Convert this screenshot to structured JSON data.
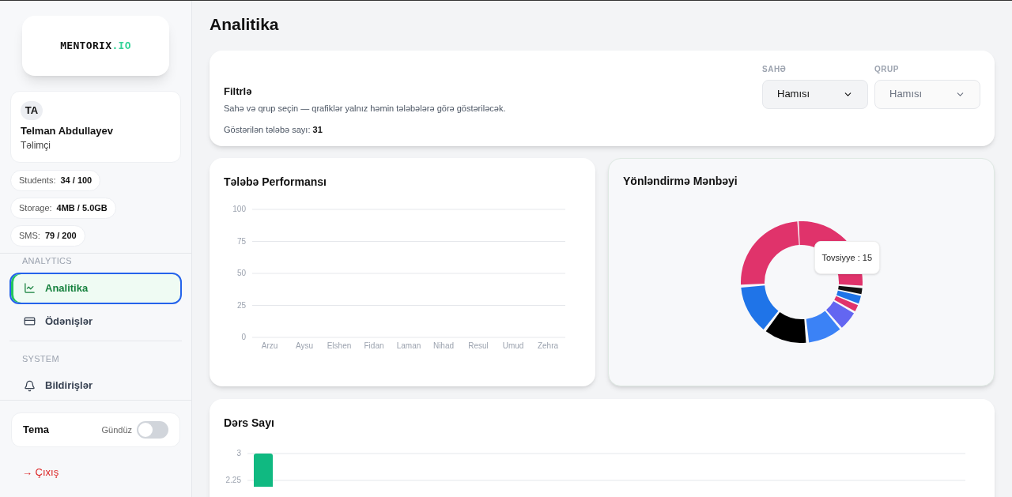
{
  "sidebar": {
    "logo": {
      "main": "MENTORIX",
      "suffix": ".IO"
    },
    "user": {
      "initials": "TA",
      "name": "Telman Abdullayev",
      "role": "Təlimçi"
    },
    "usage": [
      {
        "label": "Students:",
        "value": "34 / 100"
      },
      {
        "label": "Storage:",
        "value": "4MB / 5.0GB"
      },
      {
        "label": "SMS:",
        "value": "79 / 200"
      }
    ],
    "sections": [
      {
        "title": "ANALYTICS",
        "items": [
          {
            "label": "Analitika",
            "selected": true
          },
          {
            "label": "Ödənişlər",
            "selected": false
          }
        ]
      },
      {
        "title": "SYSTEM",
        "items": [
          {
            "label": "Bildirişlər",
            "selected": false
          }
        ]
      }
    ],
    "theme": {
      "label": "Tema",
      "mode_label": "Gündüz",
      "on": false
    },
    "logout": "→ Çıxış"
  },
  "page_title": "Analitika",
  "filter": {
    "title": "Filtrlə",
    "description": "Sahə və qrup seçin — qrafiklər yalnız həmin tələbələrə görə göstəriləcək.",
    "count_label": "Göstərilən tələbə sayı:",
    "count": "31",
    "selects": [
      {
        "label": "SAHƏ",
        "value": "Hamısı",
        "disabled": false
      },
      {
        "label": "QRUP",
        "value": "Hamısı",
        "disabled": true
      }
    ]
  },
  "performance": {
    "title": "Tələbə Performansı",
    "chart_data": {
      "type": "bar",
      "categories": [
        "Arzu",
        "Aysu",
        "Elshen",
        "Fidan",
        "Laman",
        "Nihad",
        "Resul",
        "Umud",
        "Zehra"
      ],
      "values": [
        0,
        0,
        0,
        0,
        0,
        0,
        0,
        0,
        0
      ],
      "ylim": [
        0,
        100
      ],
      "yticks": [
        0,
        25,
        50,
        75,
        100
      ],
      "grid": true
    }
  },
  "sources": {
    "title": "Yönləndirmə Mənbəyi",
    "tooltip": "Tovsiyye : 15"
  },
  "lessons": {
    "title": "Dərs Sayı",
    "chart_data": {
      "type": "bar",
      "values": [
        3
      ],
      "ylim": [
        0,
        3
      ],
      "yticks": [
        2.25,
        3
      ],
      "grid": true
    }
  }
}
